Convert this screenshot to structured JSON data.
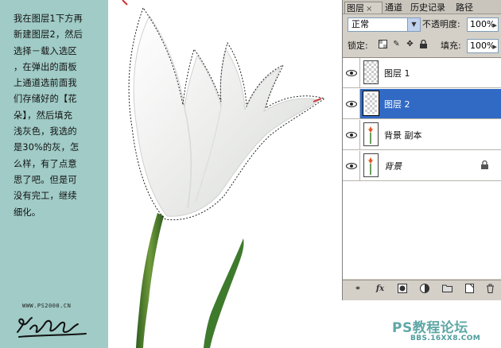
{
  "instructions": "我在图层1下方再\n新建图层2，然后\n选择－载入选区\n，在弹出的面板\n上通道选前面我\n们存储好的【花\n朵】，然后填充\n浅灰色，我选的\n是30%的灰，怎\n么样，有了点意\n思了吧。但是可\n没有完工，继续\n细化。",
  "website": "WWW.PS2000.CN",
  "tabs": [
    {
      "label": "图层",
      "active": true,
      "close": "×"
    },
    {
      "label": "通道",
      "active": false
    },
    {
      "label": "历史记录",
      "active": false
    },
    {
      "label": "路径",
      "active": false
    }
  ],
  "blend_mode": "正常",
  "opacity_label": "不透明度:",
  "opacity_value": "100%",
  "lock_label": "锁定:",
  "fill_label": "填充:",
  "fill_value": "100%",
  "layers": [
    {
      "name": "图层 1",
      "selected": false,
      "visible": true
    },
    {
      "name": "图层 2",
      "selected": true,
      "visible": true
    },
    {
      "name": "背景 副本",
      "selected": false,
      "visible": true
    },
    {
      "name": "背景",
      "selected": false,
      "visible": true,
      "locked": true
    }
  ],
  "watermark": "PS教程论坛",
  "watermark_url": "BBS.16XX8.COM",
  "colors": {
    "teal": "#a0cbc6",
    "selection": "#316ac5",
    "panel": "#d4d0c8"
  }
}
